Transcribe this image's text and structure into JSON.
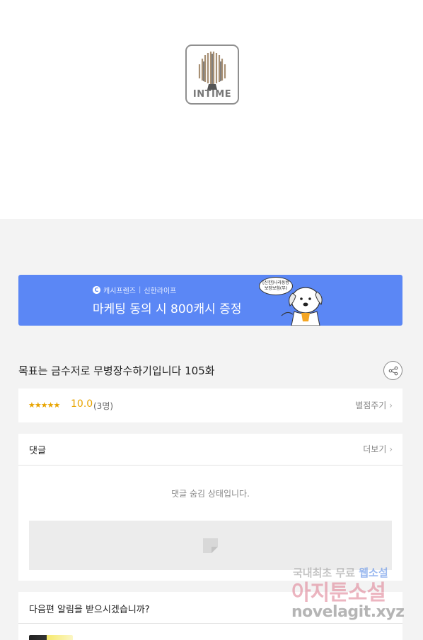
{
  "logo": {
    "text": "INTIME",
    "icon": "tree-icon"
  },
  "banner": {
    "brand_icon": "cashi-c-icon",
    "brand1": "캐시프렌즈",
    "brand2": "신한라이프",
    "title": "마케팅 동의 시 800캐시 증정",
    "bubble": "[신한]나라동방\n보장보험(무)",
    "accent_color": "#5b87f5"
  },
  "episode": {
    "title": "목표는 금수저로 무병장수하기입니다 105화",
    "share_icon": "share-icon"
  },
  "rating": {
    "stars": "★★★★★",
    "score": "10.0",
    "count": "(3명)",
    "rate_link": "별점주기"
  },
  "comments": {
    "header": "댓글",
    "more_link": "더보기",
    "hidden_message": "댓글 숨김 상태입니다."
  },
  "notify": {
    "header": "다음편 알림을 받으시겠습니까?"
  },
  "watermark": {
    "line1_a": "국내최초 무료 ",
    "line1_b": "웹소설",
    "line2": "아지툰소설",
    "line3": "novelagit.xyz"
  }
}
